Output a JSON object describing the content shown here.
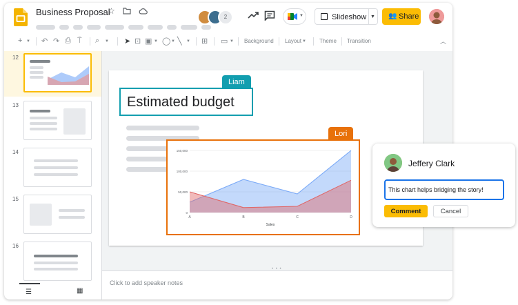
{
  "document": {
    "title": "Business Proposal"
  },
  "header": {
    "icons": [
      "star-icon",
      "move-to-folder-icon",
      "cloud-saved-icon"
    ],
    "collaborators_count": "2",
    "slideshow_label": "Slideshow",
    "share_label": "Share"
  },
  "toolbar": {
    "background_label": "Background",
    "layout_label": "Layout",
    "theme_label": "Theme",
    "transition_label": "Transition"
  },
  "slides_panel": {
    "slides": [
      {
        "number": "12",
        "active": true
      },
      {
        "number": "13",
        "active": false
      },
      {
        "number": "14",
        "active": false
      },
      {
        "number": "15",
        "active": false
      },
      {
        "number": "16",
        "active": false
      }
    ]
  },
  "slide": {
    "title": "Estimated budget",
    "collaborators": [
      {
        "name": "Liam",
        "color": "#129eaf"
      },
      {
        "name": "Lori",
        "color": "#e8710a"
      }
    ]
  },
  "chart_data": {
    "type": "area",
    "categories": [
      "A",
      "B",
      "C",
      "D"
    ],
    "series": [
      {
        "values": [
          25000,
          80000,
          45000,
          150000
        ],
        "color": "#7baaf7"
      },
      {
        "values": [
          50000,
          12000,
          15000,
          78000
        ],
        "color": "#e06666"
      }
    ],
    "xlabel": "Sales",
    "ylabel": "",
    "ylim": [
      0,
      150000
    ],
    "yticks": [
      "0",
      "50,000",
      "100,000",
      "150,000"
    ],
    "grid": true
  },
  "notes": {
    "placeholder": "Click to add speaker notes"
  },
  "comment": {
    "author": "Jeffery Clark",
    "text": "This chart helps bridging the story!",
    "comment_label": "Comment",
    "cancel_label": "Cancel"
  },
  "colors": {
    "accent": "#fbbc04",
    "slides_yellow": "#f4b400",
    "focus_blue": "#1a73e8"
  }
}
